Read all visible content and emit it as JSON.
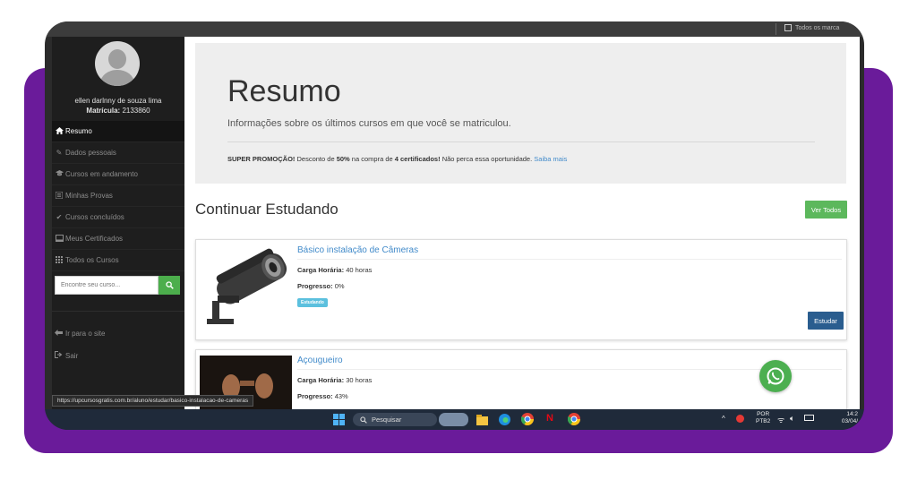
{
  "sidebar": {
    "user_name": "ellen darlnny de souza lima",
    "matricula_label": "Matrícula:",
    "matricula_value": "2133860",
    "nav": [
      {
        "label": "Resumo",
        "icon": "home-icon"
      },
      {
        "label": "Dados pessoais",
        "icon": "pencil-icon"
      },
      {
        "label": "Cursos em andamento",
        "icon": "graduation-cap-icon"
      },
      {
        "label": "Minhas Provas",
        "icon": "list-icon"
      },
      {
        "label": "Cursos concluídos",
        "icon": "check-icon"
      },
      {
        "label": "Meus Certificados",
        "icon": "certificate-icon"
      },
      {
        "label": "Todos os Cursos",
        "icon": "grid-icon"
      }
    ],
    "search_placeholder": "Encontre seu curso...",
    "links": [
      {
        "label": "Ir para o site",
        "icon": "arrow-left-icon"
      },
      {
        "label": "Sair",
        "icon": "sign-out-icon"
      }
    ]
  },
  "topbar": {
    "checkbox_label": "Todos os marca"
  },
  "jumbotron": {
    "title": "Resumo",
    "subtitle": "Informações sobre os últimos cursos em que você se matriculou.",
    "promo_strong1": "SUPER PROMOÇÃO!",
    "promo_text1": " Desconto de ",
    "promo_strong2": "50%",
    "promo_text2": " na compra de ",
    "promo_strong3": "4 certificados!",
    "promo_text3": " Não perca essa oportunidade. ",
    "promo_link": "Saiba mais"
  },
  "continue": {
    "title": "Continuar Estudando",
    "ver_todos": "Ver Todos"
  },
  "courses": [
    {
      "title": "Básico instalação de Câmeras",
      "carga_label": "Carga Horária:",
      "carga_value": "40 horas",
      "progresso_label": "Progresso:",
      "progresso_value": "0%",
      "badge": "Estudando",
      "button": "Estudar"
    },
    {
      "title": "Açougueiro",
      "carga_label": "Carga Horária:",
      "carga_value": "30 horas",
      "progresso_label": "Progresso:",
      "progresso_value": "43%"
    }
  ],
  "status_url": "https://upcursosgratis.com.br/aluno/estudar/basico-instalacao-de-cameras",
  "taskbar": {
    "search_label": "Pesquisar",
    "lang_line1": "POR",
    "lang_line2": "PTB2",
    "time": "14:2",
    "date": "03/04/"
  },
  "colors": {
    "purple_bg": "#6a1b9a",
    "sidebar_bg": "#1e1e1e",
    "green": "#5cb85c",
    "link_blue": "#428bca",
    "button_blue": "#2a5d8f"
  }
}
